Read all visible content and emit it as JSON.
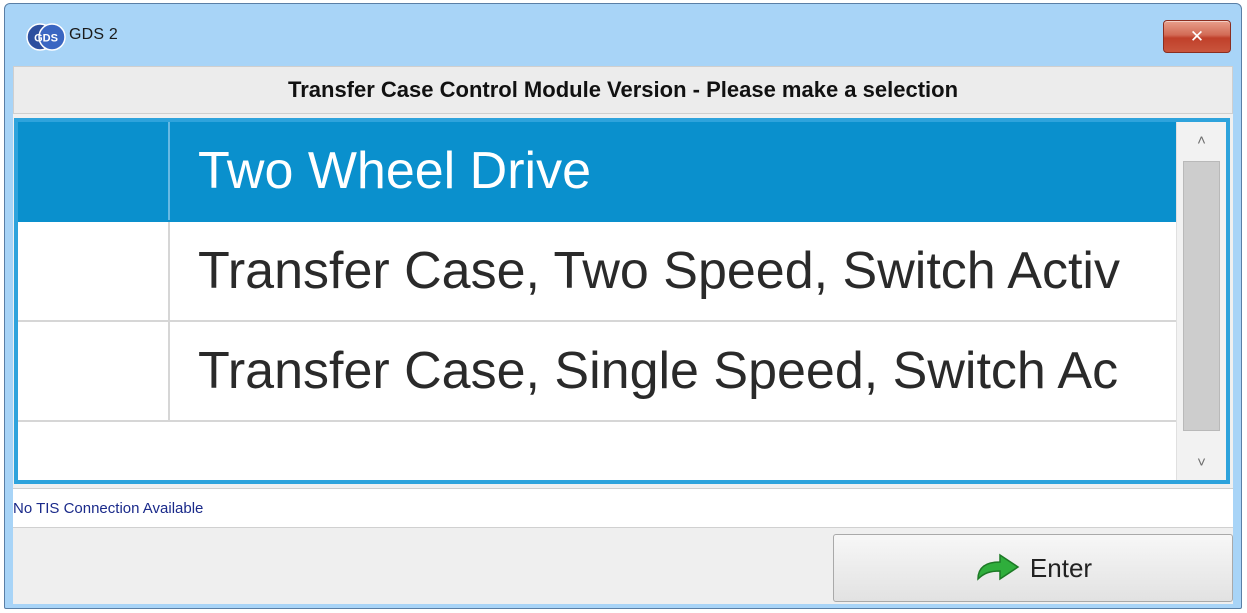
{
  "window": {
    "title": "GDS 2",
    "logo_text": "GDS",
    "close_icon": "close-icon",
    "close_glyph": "✕"
  },
  "header": {
    "title": "Transfer Case Control Module Version - Please make a selection"
  },
  "list": {
    "items": [
      {
        "label": "Two Wheel Drive",
        "selected": true
      },
      {
        "label": "Transfer Case, Two Speed, Switch Activ",
        "selected": false
      },
      {
        "label": "Transfer Case, Single Speed, Switch Ac",
        "selected": false
      }
    ],
    "scroll_up_glyph": "˄",
    "scroll_down_glyph": "˅"
  },
  "status": {
    "text": "No TIS Connection Available"
  },
  "footer": {
    "enter_label": "Enter",
    "enter_icon": "green-arrow-icon"
  },
  "colors": {
    "title_bar": "#a8d4f7",
    "selection": "#0a90cd",
    "list_border": "#2ea3dc",
    "close_button": "#c9553d",
    "status_text": "#1a2a8a"
  }
}
